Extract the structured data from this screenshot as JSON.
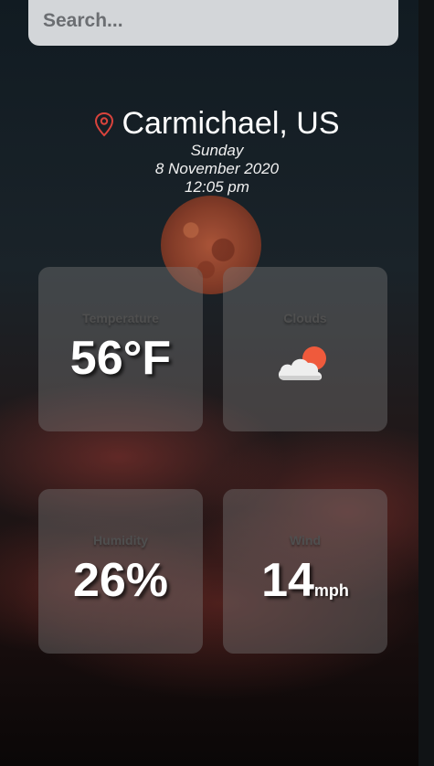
{
  "search": {
    "placeholder": "Search..."
  },
  "location": {
    "city": "Carmichael, US",
    "day": "Sunday",
    "date": "8 November 2020",
    "time": "12:05 pm"
  },
  "cards": {
    "temperature": {
      "label": "Temperature",
      "value": "56°F"
    },
    "clouds": {
      "label": "Clouds",
      "icon": "sun-behind-cloud-icon"
    },
    "humidity": {
      "label": "Humidity",
      "value": "26%"
    },
    "wind": {
      "label": "Wind",
      "value": "14",
      "unit": "mph"
    }
  },
  "colors": {
    "pin": "#d9433c",
    "sun": "#ef5a3c"
  }
}
